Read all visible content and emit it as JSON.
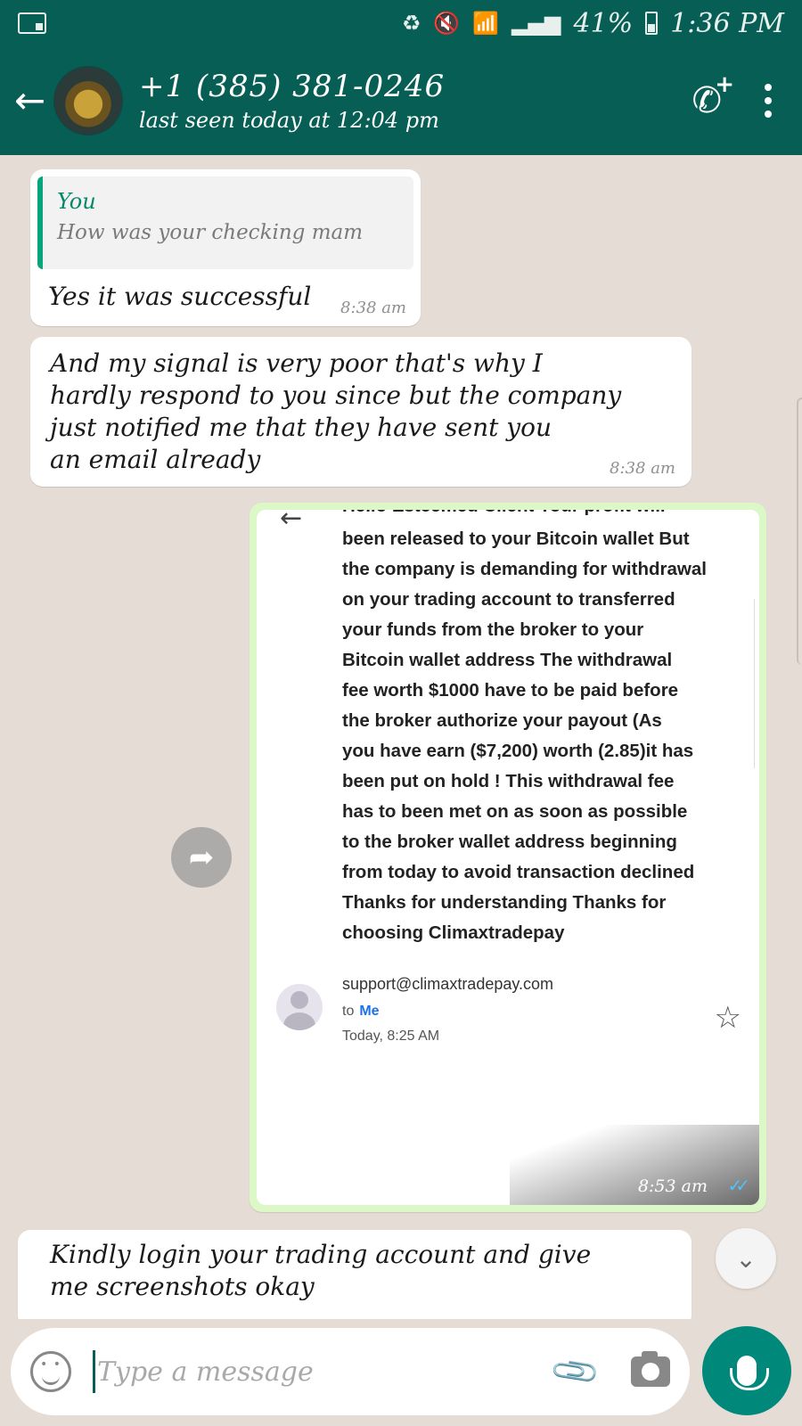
{
  "status_bar": {
    "battery": "41%",
    "time": "1:36 PM"
  },
  "header": {
    "contact_name": "+1 (385) 381-0246",
    "last_seen": "last seen today at 12:04 pm"
  },
  "messages": [
    {
      "quote_author": "You",
      "quote_text": "How was  your checking mam",
      "text": "Yes it was successful",
      "time": "8:38 am"
    },
    {
      "lines": [
        "And my signal is very poor that's why I",
        "hardly respond to you since but the company",
        "just notified me that they have sent you",
        "an email already"
      ],
      "time": "8:38 am"
    }
  ],
  "email_image": {
    "cut_top_line": "Hello Esteemed Client Your profit will",
    "body_lines": [
      "been released to your Bitcoin wallet But",
      "the company is demanding for withdrawal",
      "on your trading account to transferred",
      "your funds from the broker to your",
      "Bitcoin wallet address The withdrawal",
      "fee worth $1000 have to be paid before",
      "the broker authorize your payout (As",
      "you have earn ($7,200) worth (2.85)it has",
      "been put on hold ! This withdrawal fee",
      "has to been met on as soon as possible",
      "to the broker wallet address beginning",
      "from today to avoid transaction declined",
      "Thanks for understanding Thanks for",
      "choosing Climaxtradepay"
    ],
    "sender_email": "support@climaxtradepay.com",
    "to_label": "to",
    "to_value": "Me",
    "date": "Today, 8:25 AM",
    "time": "8:53 am"
  },
  "last_message": {
    "lines": [
      "Kindly login your trading account and give",
      "me screenshots okay"
    ]
  },
  "input": {
    "placeholder": "Type a message"
  },
  "colors": {
    "header": "#075e54",
    "accent": "#00897b",
    "outgoing_bubble": "#dcf8c6",
    "chat_background": "#e5ddd5"
  }
}
